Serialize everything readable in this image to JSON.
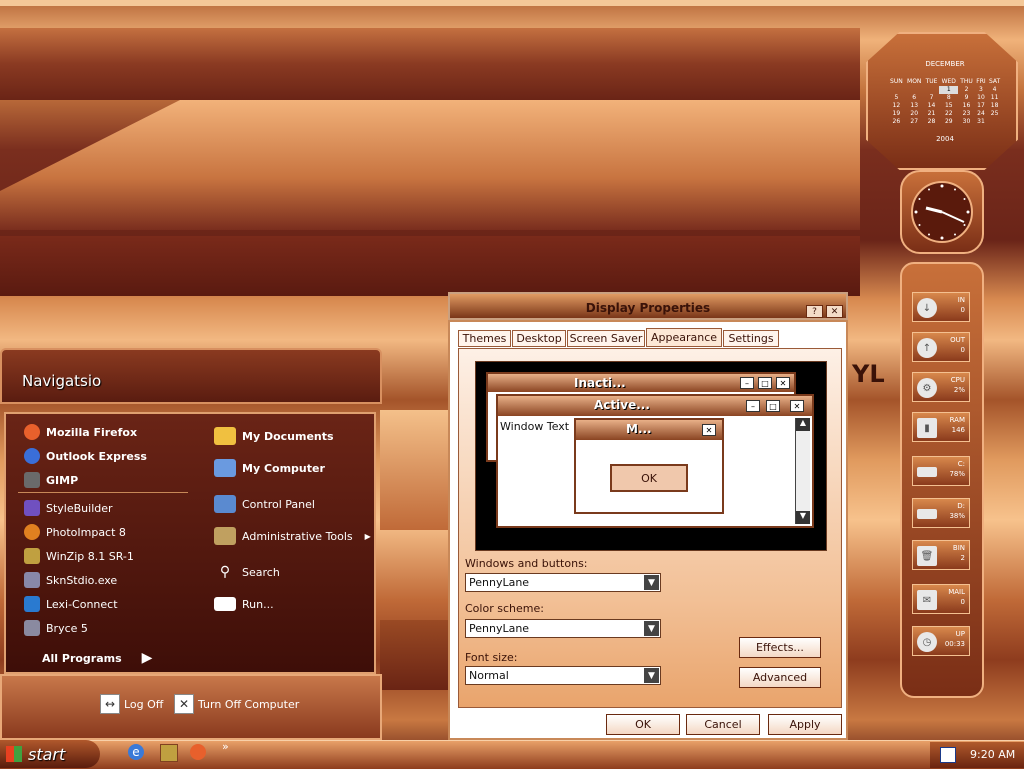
{
  "desktop": {
    "partial_text": "YL"
  },
  "start_menu": {
    "title": "Navigatsio",
    "pinned": [
      {
        "label": "Mozilla Firefox",
        "icon": "firefox-icon",
        "color": "#e8602c"
      },
      {
        "label": "Outlook Express",
        "icon": "outlook-express-icon",
        "color": "#3a6ed8"
      },
      {
        "label": "GIMP",
        "icon": "gimp-icon",
        "color": "#6a6a6a"
      }
    ],
    "recent": [
      {
        "label": "StyleBuilder",
        "icon": "stylebuilder-icon",
        "color": "#7050c0"
      },
      {
        "label": "PhotoImpact 8",
        "icon": "photoimpact-icon",
        "color": "#e08020"
      },
      {
        "label": "WinZip 8.1 SR-1",
        "icon": "winzip-icon",
        "color": "#c0a040"
      },
      {
        "label": "SknStdio.exe",
        "icon": "skinstudio-icon",
        "color": "#8888a8"
      },
      {
        "label": "Lexi-Connect",
        "icon": "lexi-connect-icon",
        "color": "#2a7ad0"
      },
      {
        "label": "Bryce 5",
        "icon": "bryce-icon",
        "color": "#8a8aa0"
      }
    ],
    "all_programs": "All Programs",
    "places": [
      {
        "label": "My Documents",
        "icon": "folder-documents-icon",
        "color": "#f0c040",
        "bold": true
      },
      {
        "label": "My Computer",
        "icon": "computer-icon",
        "color": "#6a9ae0",
        "bold": true
      },
      {
        "label": "Control Panel",
        "icon": "control-panel-icon",
        "color": "#5a8ad0"
      },
      {
        "label": "Administrative Tools",
        "icon": "admin-tools-icon",
        "color": "#c0a060"
      },
      {
        "label": "Search",
        "icon": "search-icon",
        "color": "#ffffff"
      },
      {
        "label": "Run...",
        "icon": "run-icon",
        "color": "#ffffff"
      }
    ],
    "log_off": "Log Off",
    "turn_off": "Turn Off Computer"
  },
  "display_properties": {
    "title": "Display Properties",
    "tabs": [
      "Themes",
      "Desktop",
      "Screen Saver",
      "Appearance",
      "Settings"
    ],
    "active_tab": "Appearance",
    "preview": {
      "inactive_title": "Inacti...",
      "active_title": "Active...",
      "window_text": "Window Text",
      "message_title": "M...",
      "ok": "OK"
    },
    "windows_buttons_label": "Windows and buttons:",
    "windows_buttons_value": "PennyLane",
    "color_scheme_label": "Color scheme:",
    "color_scheme_value": "PennyLane",
    "font_size_label": "Font size:",
    "font_size_value": "Normal",
    "effects": "Effects...",
    "advanced": "Advanced",
    "ok": "OK",
    "cancel": "Cancel",
    "apply": "Apply"
  },
  "calendar": {
    "month": "DECEMBER",
    "year": "2004",
    "days": [
      "SUN",
      "MON",
      "TUE",
      "WED",
      "THU",
      "FRI",
      "SAT"
    ],
    "weeks": [
      [
        "",
        "",
        "",
        "1",
        "2",
        "3",
        "4"
      ],
      [
        "5",
        "6",
        "7",
        "8",
        "9",
        "10",
        "11"
      ],
      [
        "12",
        "13",
        "14",
        "15",
        "16",
        "17",
        "18"
      ],
      [
        "19",
        "20",
        "21",
        "22",
        "23",
        "24",
        "25"
      ],
      [
        "26",
        "27",
        "28",
        "29",
        "30",
        "31",
        ""
      ]
    ],
    "today": "1"
  },
  "monitors": [
    {
      "name": "IN",
      "value": "0",
      "icon": "network-in-icon"
    },
    {
      "name": "OUT",
      "value": "0",
      "icon": "network-out-icon"
    },
    {
      "name": "CPU",
      "value": "2%",
      "icon": "cpu-icon"
    },
    {
      "name": "RAM",
      "value": "146",
      "icon": "ram-icon"
    },
    {
      "name": "C:",
      "value": "78%",
      "icon": "drive-c-icon"
    },
    {
      "name": "D:",
      "value": "38%",
      "icon": "drive-d-icon"
    },
    {
      "name": "BIN",
      "value": "2",
      "icon": "recycle-bin-icon"
    },
    {
      "name": "MAIL",
      "value": "0",
      "icon": "mail-icon"
    },
    {
      "name": "UP",
      "value": "00:33",
      "icon": "uptime-icon"
    }
  ],
  "taskbar": {
    "start": "start",
    "quick_launch": [
      "internet-explorer-icon",
      "winzip-icon",
      "firefox-icon"
    ],
    "chevron": "»",
    "clock": "9:20 AM"
  }
}
